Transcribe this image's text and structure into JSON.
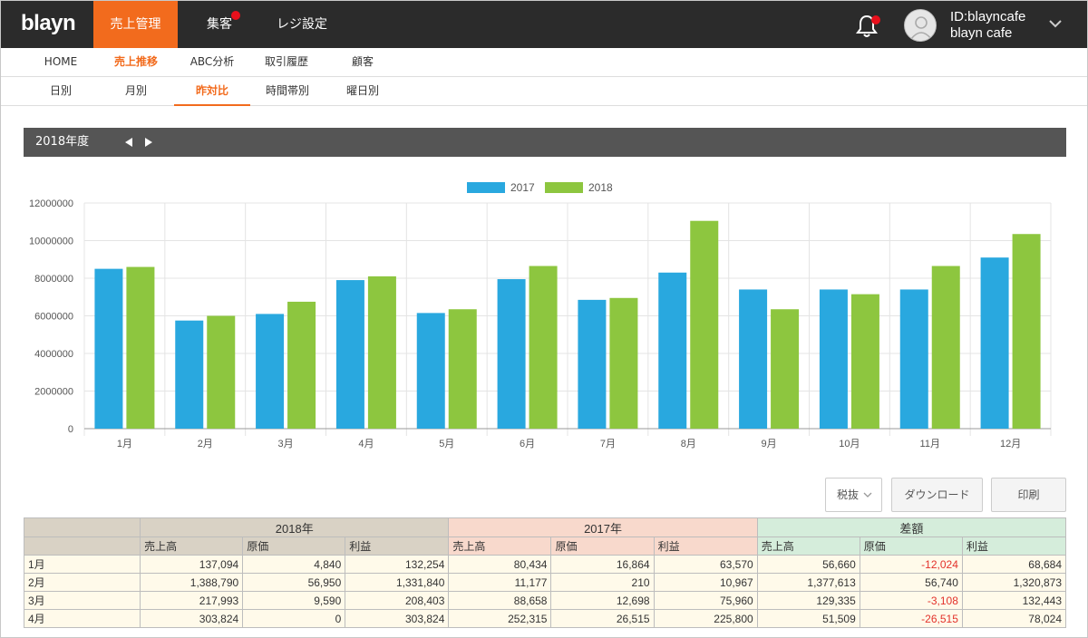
{
  "app": {
    "logo": "blayn"
  },
  "nav": {
    "items": [
      {
        "label": "売上管理",
        "active": true
      },
      {
        "label": "集客",
        "badge": true
      },
      {
        "label": "レジ設定"
      }
    ]
  },
  "user": {
    "id": "ID:blayncafe",
    "name": "blayn cafe"
  },
  "subnav1": [
    "HOME",
    "売上推移",
    "ABC分析",
    "取引履歴",
    "顧客"
  ],
  "subnav2": [
    "日別",
    "月別",
    "昨対比",
    "時間帯別",
    "曜日別"
  ],
  "yearbar": {
    "label": "2018年度"
  },
  "colors": {
    "accent": "#f26b1d",
    "series2017": "#29a8df",
    "series2018": "#8dc63f",
    "negative": "#e3322b"
  },
  "chart_data": {
    "type": "bar",
    "categories": [
      "1月",
      "2月",
      "3月",
      "4月",
      "5月",
      "6月",
      "7月",
      "8月",
      "9月",
      "10月",
      "11月",
      "12月"
    ],
    "series": [
      {
        "name": "2017",
        "values": [
          8500000,
          5750000,
          6100000,
          7900000,
          6150000,
          7950000,
          6850000,
          8300000,
          7400000,
          7400000,
          7400000,
          9100000
        ]
      },
      {
        "name": "2018",
        "values": [
          8600000,
          6000000,
          6750000,
          8100000,
          6350000,
          8650000,
          6950000,
          11050000,
          6350000,
          7150000,
          8650000,
          10350000
        ]
      }
    ],
    "ylim": [
      0,
      12000000
    ],
    "yticks": [
      "0",
      "2000000",
      "4000000",
      "6000000",
      "8000000",
      "10000000",
      "12000000"
    ],
    "legend": "top-center",
    "grid": true
  },
  "controls": {
    "tax": "税抜",
    "download": "ダウンロード",
    "print": "印刷"
  },
  "table": {
    "groups": [
      "2018年",
      "2017年",
      "差額"
    ],
    "subheaders": [
      "売上高",
      "原価",
      "利益",
      "売上高",
      "原価",
      "利益",
      "売上高",
      "原価",
      "利益"
    ],
    "rows": [
      {
        "month": "1月",
        "cells": [
          "137,094",
          "4,840",
          "132,254",
          "80,434",
          "16,864",
          "63,570",
          "56,660",
          "-12,024",
          "68,684"
        ]
      },
      {
        "month": "2月",
        "cells": [
          "1,388,790",
          "56,950",
          "1,331,840",
          "11,177",
          "210",
          "10,967",
          "1,377,613",
          "56,740",
          "1,320,873"
        ]
      },
      {
        "month": "3月",
        "cells": [
          "217,993",
          "9,590",
          "208,403",
          "88,658",
          "12,698",
          "75,960",
          "129,335",
          "-3,108",
          "132,443"
        ]
      },
      {
        "month": "4月",
        "cells": [
          "303,824",
          "0",
          "303,824",
          "252,315",
          "26,515",
          "225,800",
          "51,509",
          "-26,515",
          "78,024"
        ]
      }
    ]
  }
}
